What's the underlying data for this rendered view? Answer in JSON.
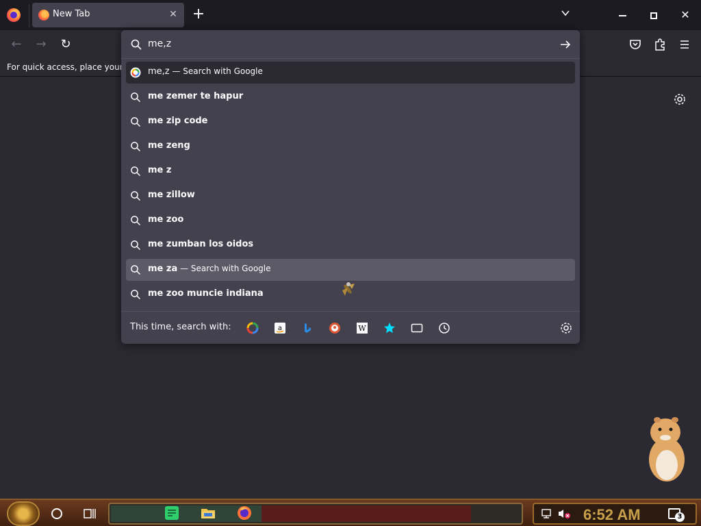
{
  "browser": {
    "tab": {
      "title": "New Tab",
      "close": "✕"
    },
    "new_tab_symbol": "+",
    "tablist_symbol": "⌄",
    "window": {
      "close_symbol": "✕"
    },
    "nav": {
      "back": "←",
      "forward": "→",
      "reload": "↻"
    },
    "bookmarks_hint": "For quick access, place your b"
  },
  "urlbar": {
    "value": "me,z",
    "results": [
      {
        "text": "me,z",
        "suffix": " — Search with Google",
        "icon": "google-icon",
        "style": "first"
      },
      {
        "text": "me zemer te hapur",
        "icon": "search-icon"
      },
      {
        "text": "me zip code",
        "icon": "search-icon"
      },
      {
        "text": "me zeng",
        "icon": "search-icon"
      },
      {
        "text": "me z",
        "icon": "search-icon"
      },
      {
        "text": "me zillow",
        "icon": "search-icon"
      },
      {
        "text": "me zoo",
        "icon": "search-icon"
      },
      {
        "text": "me zumban los oidos",
        "icon": "search-icon"
      },
      {
        "text": "me za",
        "suffix": " — Search with Google",
        "icon": "search-icon",
        "style": "hover"
      },
      {
        "text": "me zoo muncie indiana",
        "icon": "search-icon"
      }
    ],
    "oneoff_label": "This time, search with:",
    "engines": [
      "google-icon",
      "amazon-icon",
      "bing-icon",
      "duckduckgo-icon",
      "wikipedia-icon",
      "bookmarks-star-icon",
      "tabs-icon",
      "history-icon"
    ]
  },
  "taskbar": {
    "clock": "6:52 AM",
    "notification_count": "3"
  },
  "colors": {
    "panel": "#42414d",
    "page_bg": "#2b2a33",
    "tabstrip": "#1c1b22",
    "accent_clock": "#c8a04b"
  }
}
